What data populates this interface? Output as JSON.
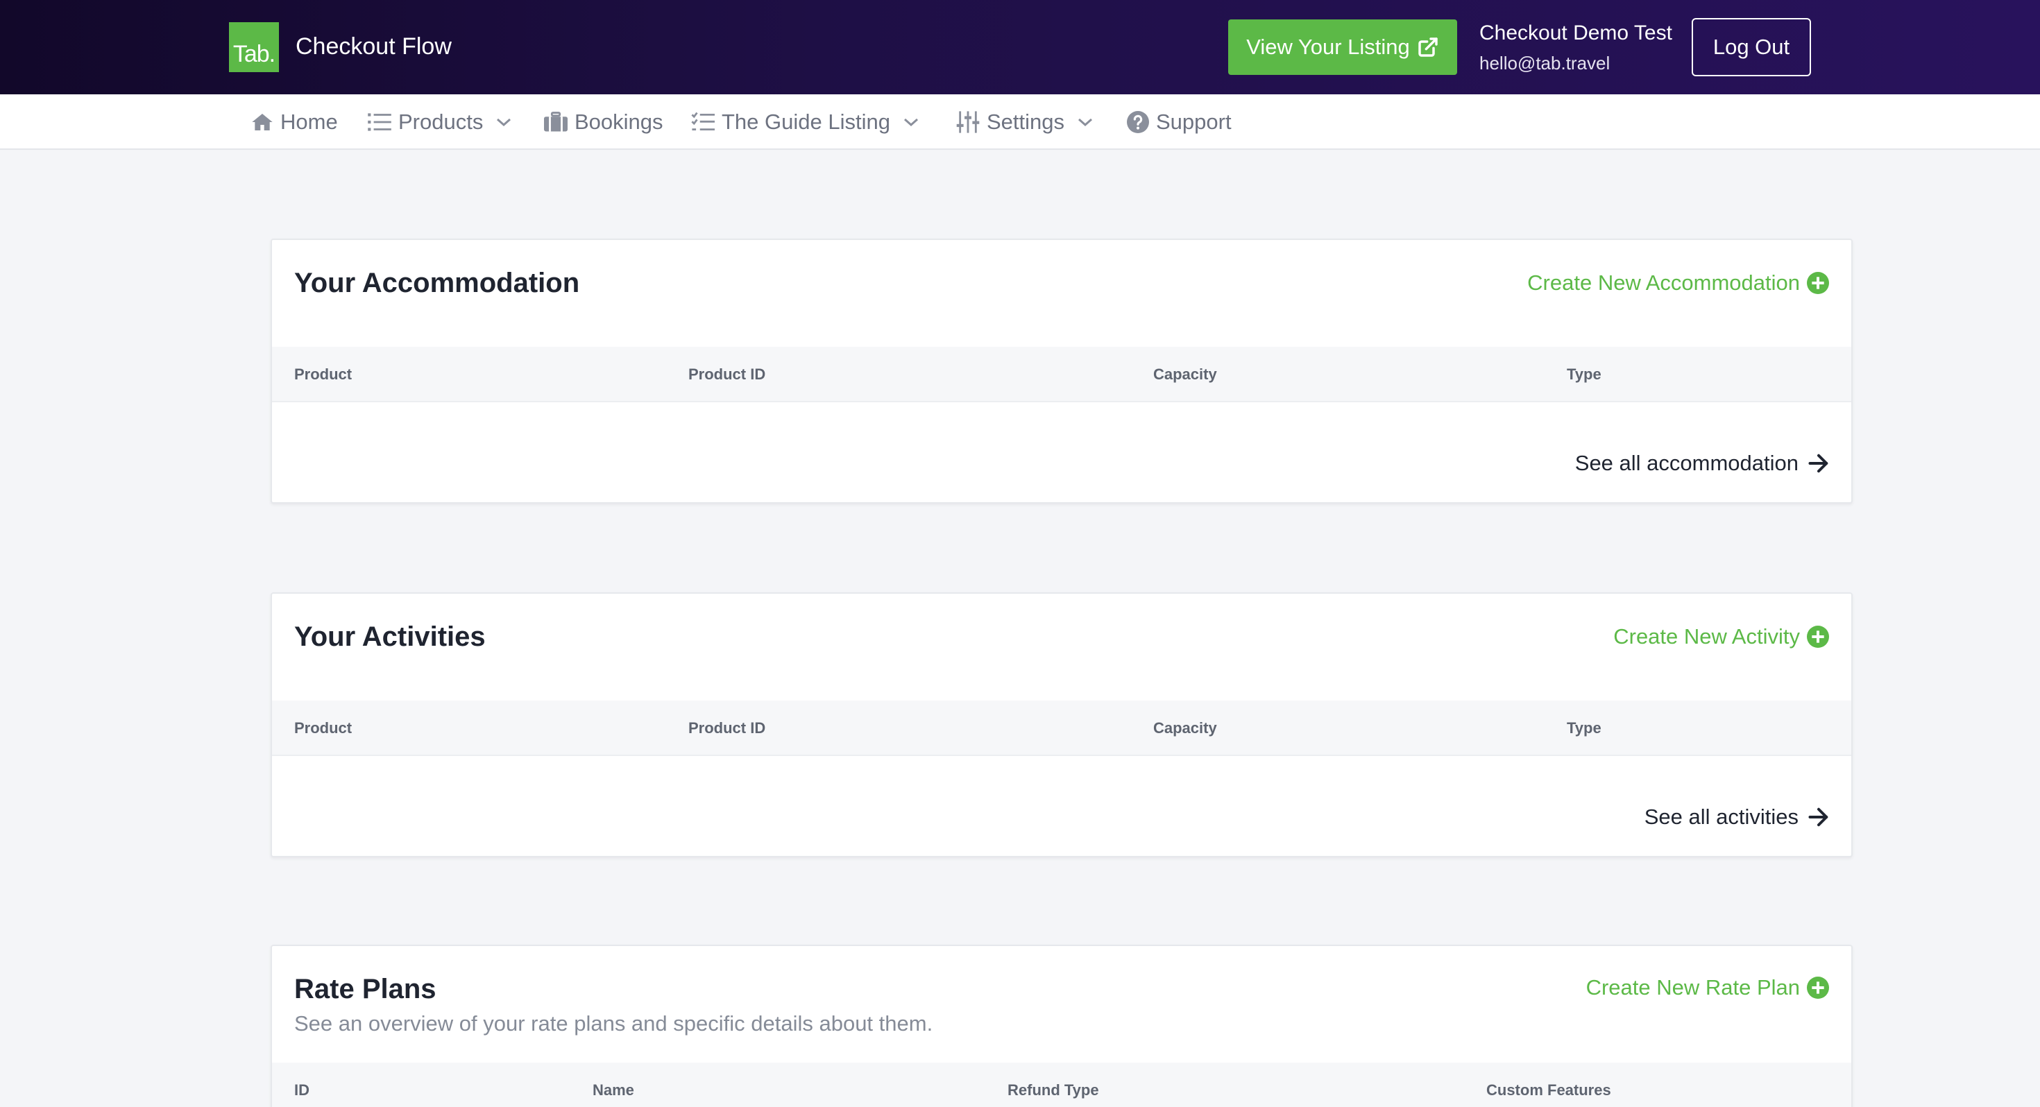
{
  "header": {
    "logo_text": "Tab.",
    "app_title": "Checkout Flow",
    "view_listing_label": "View Your Listing",
    "user_name": "Checkout Demo Test",
    "user_email": "hello@tab.travel",
    "logout_label": "Log Out"
  },
  "nav": {
    "items": [
      {
        "label": "Home",
        "icon": "home-icon"
      },
      {
        "label": "Products",
        "icon": "list-icon",
        "dropdown": true
      },
      {
        "label": "Bookings",
        "icon": "luggage-icon"
      },
      {
        "label": "The Guide Listing",
        "icon": "checklist-icon",
        "dropdown": true
      },
      {
        "label": "Settings",
        "icon": "sliders-icon",
        "dropdown": true
      },
      {
        "label": "Support",
        "icon": "question-circle-icon"
      }
    ]
  },
  "accommodation": {
    "title": "Your Accommodation",
    "create_label": "Create New Accommodation",
    "columns": [
      "Product",
      "Product ID",
      "Capacity",
      "Type"
    ],
    "rows": [],
    "see_all_label": "See all accommodation"
  },
  "activities": {
    "title": "Your Activities",
    "create_label": "Create New Activity",
    "columns": [
      "Product",
      "Product ID",
      "Capacity",
      "Type"
    ],
    "rows": [],
    "see_all_label": "See all activities"
  },
  "rate_plans": {
    "title": "Rate Plans",
    "subtitle": "See an overview of your rate plans and specific details about them.",
    "create_label": "Create New Rate Plan",
    "columns": [
      "ID",
      "Name",
      "Refund Type",
      "Custom Features"
    ]
  },
  "colors": {
    "brand_green": "#5cb947",
    "header_bg": "#1e0f45",
    "page_bg": "#f4f5f8"
  }
}
